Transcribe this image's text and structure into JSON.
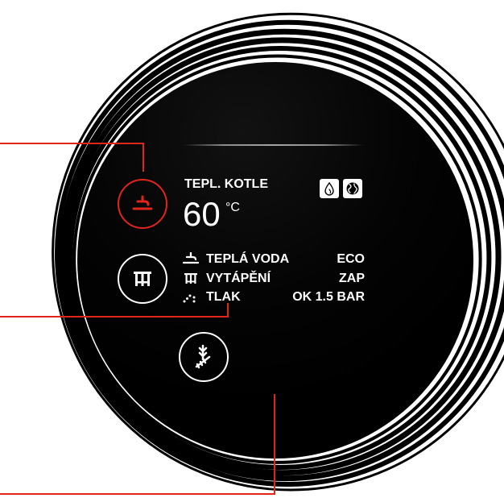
{
  "colors": {
    "accent": "#e1251b",
    "display_background": "#000000",
    "text": "#ffffff",
    "page_background": "#ffffff"
  },
  "display": {
    "title": "TEPL. KOTLE",
    "temperature": {
      "value": "60",
      "unit": "°C"
    },
    "status_icons": [
      {
        "icon": "flame-icon"
      },
      {
        "icon": "globe-icon"
      }
    ],
    "rows": [
      {
        "icon": "tap-icon",
        "label": "TEPLÁ VODA",
        "value": "ECO"
      },
      {
        "icon": "radiator-icon",
        "label": "VYTÁPĚNÍ",
        "value": "ZAP"
      },
      {
        "icon": "pressure-icon",
        "label": "TLAK",
        "value": "OK 1.5 BAR"
      }
    ]
  },
  "buttons": [
    {
      "name": "hot-water",
      "icon": "tap-icon",
      "active": true
    },
    {
      "name": "heating",
      "icon": "radiator-icon",
      "active": false
    },
    {
      "name": "chimney-sweep",
      "icon": "chimney-sweep-icon",
      "active": false
    }
  ]
}
